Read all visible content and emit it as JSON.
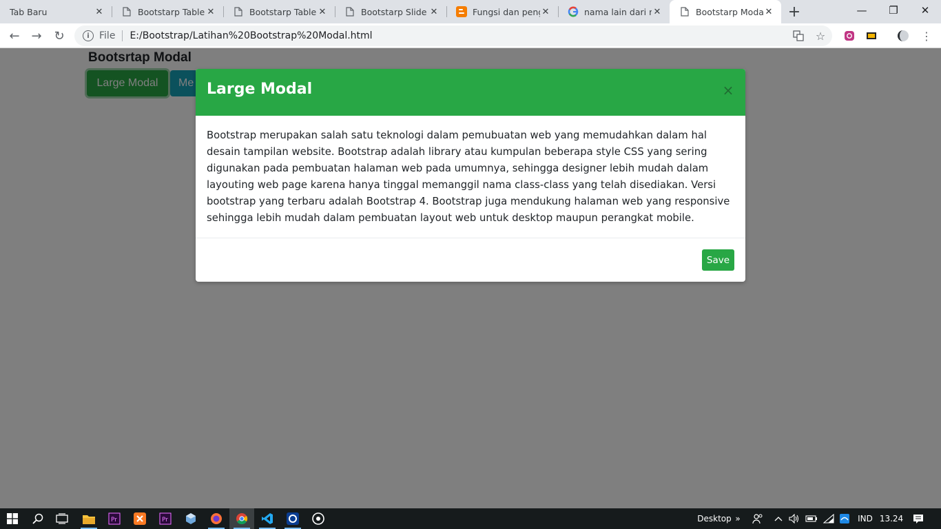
{
  "browser": {
    "tabs": [
      {
        "label": "Tab Baru",
        "icon": "none",
        "active": false
      },
      {
        "label": "Bootstarp Table",
        "icon": "page-icon",
        "active": false
      },
      {
        "label": "Bootstarp Table",
        "icon": "page-icon",
        "active": false
      },
      {
        "label": "Bootstarp Slide",
        "icon": "page-icon",
        "active": false
      },
      {
        "label": "Fungsi dan pengertian",
        "icon": "blogger-icon",
        "active": false
      },
      {
        "label": "nama lain dari menu",
        "icon": "google-icon",
        "active": false
      },
      {
        "label": "Bootstarp Modal",
        "icon": "page-icon",
        "active": true
      }
    ],
    "address": {
      "scheme_label": "File",
      "url": "E:/Bootstrap/Latihan%20Bootstrap%20Modal.html"
    }
  },
  "page": {
    "title": "Bootsrtap Modal",
    "buttons": {
      "large": "Large Modal",
      "medium": "Me"
    }
  },
  "modal": {
    "title": "Large Modal",
    "close_glyph": "×",
    "body": "Bootstrap merupakan salah satu teknologi dalam pemubuatan web yang memudahkan dalam hal desain tampilan website. Bootstrap adalah library atau kumpulan beberapa style CSS yang sering digunakan pada pembuatan halaman web pada umumnya, sehingga designer lebih mudah dalam layouting web page karena hanya tinggal memanggil nama class-class yang telah disediakan. Versi bootstrap yang terbaru adalah Bootstrap 4. Bootstrap juga mendukung halaman web yang responsive sehingga lebih mudah dalam pembuatan layout web untuk desktop maupun perangkat mobile.",
    "save_label": "Save",
    "header_color": "#28a745"
  },
  "taskbar": {
    "desktop_label": "Desktop",
    "language": "IND",
    "time": "13.24"
  }
}
